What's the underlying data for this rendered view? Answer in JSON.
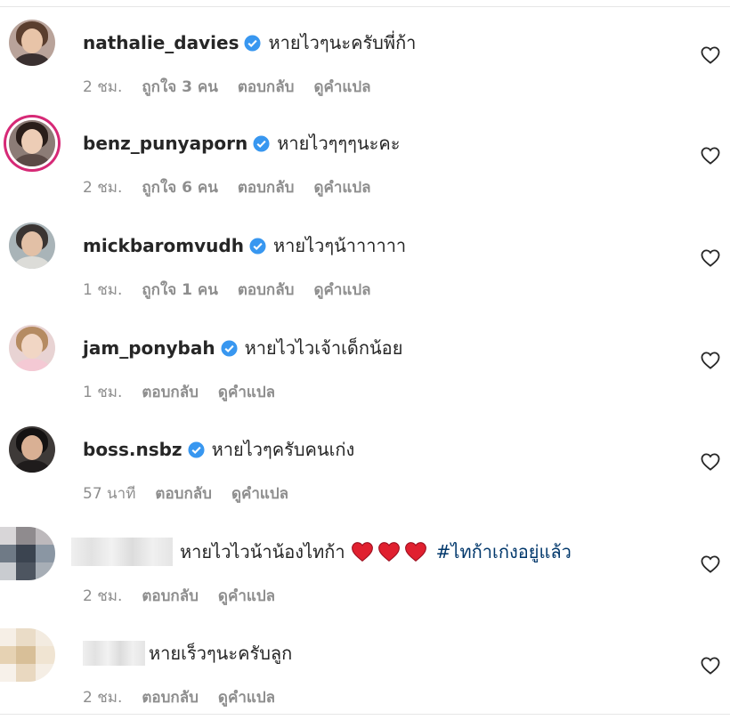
{
  "comments": [
    {
      "username": "nathalie_davies",
      "verified": true,
      "text": "หายไวๆนะครับพี่ก้า",
      "time": "2 ชม.",
      "likes": "ถูกใจ 3 คน",
      "reply": "ตอบกลับ",
      "translate": "ดูคำแปล"
    },
    {
      "username": "benz_punyaporn",
      "verified": true,
      "text": "หายไวๆๆๆนะคะ",
      "time": "2 ชม.",
      "likes": "ถูกใจ 6 คน",
      "reply": "ตอบกลับ",
      "translate": "ดูคำแปล"
    },
    {
      "username": "mickbaromvudh",
      "verified": true,
      "text": "หายไวๆน้าาาาาา",
      "time": "1 ชม.",
      "likes": "ถูกใจ 1 คน",
      "reply": "ตอบกลับ",
      "translate": "ดูคำแปล"
    },
    {
      "username": "jam_ponybah",
      "verified": true,
      "text": "หายไวไวเจ้าเด็กน้อย",
      "time": "1 ชม.",
      "reply": "ตอบกลับ",
      "translate": "ดูคำแปล"
    },
    {
      "username": "boss.nsbz",
      "verified": true,
      "text": "หายไวๆครับคนเก่ง",
      "time": "57 นาที",
      "reply": "ตอบกลับ",
      "translate": "ดูคำแปล"
    },
    {
      "username": "",
      "text": "หายไวไวน้าน้องไทก้า",
      "hashtag": "#ไทก้าเก่งอยู่แล้ว",
      "time": "2 ชม.",
      "reply": "ตอบกลับ",
      "translate": "ดูคำแปล"
    },
    {
      "username": "",
      "text": "หายเร็วๆนะครับลูก",
      "time": "2 ชม.",
      "reply": "ตอบกลับ",
      "translate": "ดูคำแปล"
    }
  ],
  "icons": {
    "verified": "verified-badge-icon",
    "like": "heart-outline-icon",
    "emoji": "red-heart-emoji"
  },
  "colors": {
    "verified": "#3897f0",
    "hashtag": "#00376b",
    "meta": "#8e8e8e",
    "heart": "#e0202f"
  }
}
